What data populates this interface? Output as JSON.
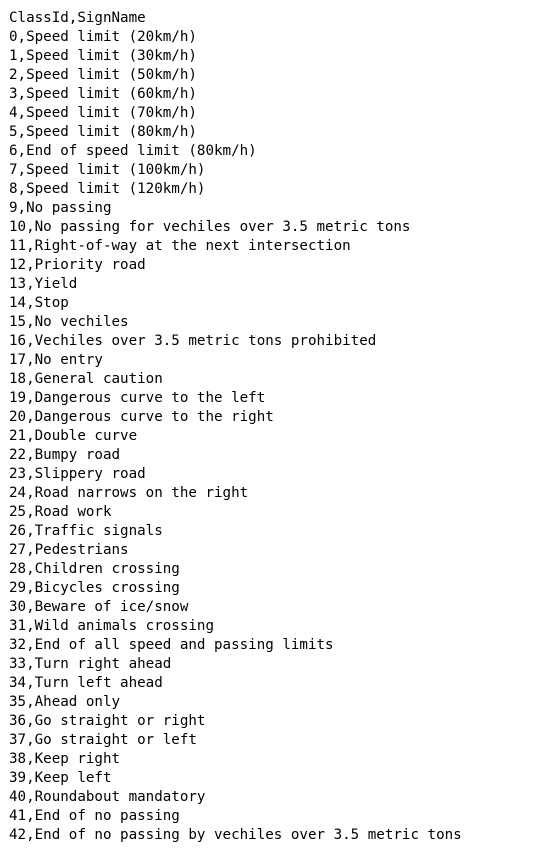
{
  "lines": [
    "ClassId,SignName",
    "0,Speed limit (20km/h)",
    "1,Speed limit (30km/h)",
    "2,Speed limit (50km/h)",
    "3,Speed limit (60km/h)",
    "4,Speed limit (70km/h)",
    "5,Speed limit (80km/h)",
    "6,End of speed limit (80km/h)",
    "7,Speed limit (100km/h)",
    "8,Speed limit (120km/h)",
    "9,No passing",
    "10,No passing for vechiles over 3.5 metric tons",
    "11,Right-of-way at the next intersection",
    "12,Priority road",
    "13,Yield",
    "14,Stop",
    "15,No vechiles",
    "16,Vechiles over 3.5 metric tons prohibited",
    "17,No entry",
    "18,General caution",
    "19,Dangerous curve to the left",
    "20,Dangerous curve to the right",
    "21,Double curve",
    "22,Bumpy road",
    "23,Slippery road",
    "24,Road narrows on the right",
    "25,Road work",
    "26,Traffic signals",
    "27,Pedestrians",
    "28,Children crossing",
    "29,Bicycles crossing",
    "30,Beware of ice/snow",
    "31,Wild animals crossing",
    "32,End of all speed and passing limits",
    "33,Turn right ahead",
    "34,Turn left ahead",
    "35,Ahead only",
    "36,Go straight or right",
    "37,Go straight or left",
    "38,Keep right",
    "39,Keep left",
    "40,Roundabout mandatory",
    "41,End of no passing",
    "42,End of no passing by vechiles over 3.5 metric tons"
  ]
}
